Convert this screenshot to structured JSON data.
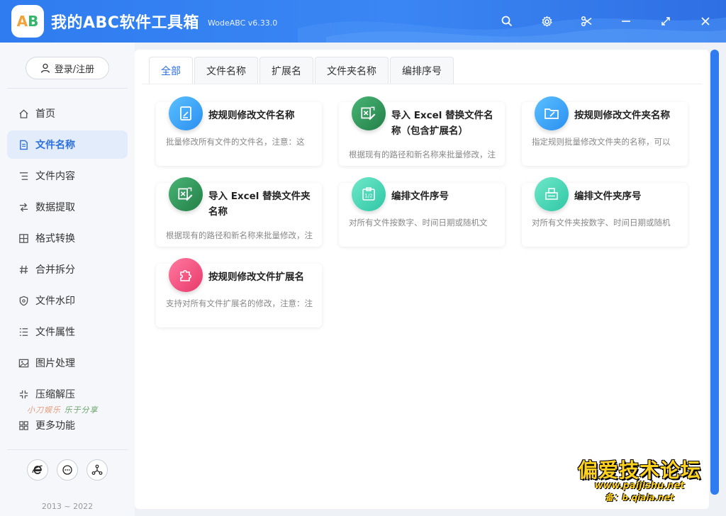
{
  "app": {
    "title": "我的ABC软件工具箱",
    "version": "WodeABC v6.33.0",
    "logo_text": "AB"
  },
  "window_buttons": [
    "search-icon",
    "gear-icon",
    "scissors-icon",
    "minimize-icon",
    "maximize-icon",
    "close-icon"
  ],
  "sidebar": {
    "login_label": "登录/注册",
    "items": [
      {
        "label": "首页",
        "icon": "home-icon"
      },
      {
        "label": "文件名称",
        "icon": "file-icon",
        "active": true
      },
      {
        "label": "文件内容",
        "icon": "list-icon"
      },
      {
        "label": "数据提取",
        "icon": "extract-icon"
      },
      {
        "label": "格式转换",
        "icon": "convert-icon"
      },
      {
        "label": "合并拆分",
        "icon": "hash-icon"
      },
      {
        "label": "文件水印",
        "icon": "shield-icon"
      },
      {
        "label": "文件属性",
        "icon": "properties-icon"
      },
      {
        "label": "图片处理",
        "icon": "image-icon"
      },
      {
        "label": "压缩解压",
        "icon": "compress-icon"
      },
      {
        "label": "更多功能",
        "icon": "grid-icon"
      }
    ],
    "bottom_icons": [
      "ie-icon",
      "chat-icon",
      "share-icon"
    ],
    "copyright": "2013 ~ 2022"
  },
  "tabs": [
    {
      "label": "全部",
      "active": true
    },
    {
      "label": "文件名称"
    },
    {
      "label": "扩展名"
    },
    {
      "label": "文件夹名称"
    },
    {
      "label": "编排序号"
    }
  ],
  "cards": [
    {
      "title": "按规则修改文件名称",
      "desc": "批量修改所有文件的文件名，注意：这",
      "icon": "edit-document-icon",
      "color": "#3aa6f6"
    },
    {
      "title": "导入 Excel 替换文件名称（包含扩展名）",
      "desc": "根据现有的路径和新名称来批量修改，注",
      "icon": "excel-icon",
      "color": "#2f9a5a"
    },
    {
      "title": "按规则修改文件夹名称",
      "desc": "指定规则批量修改文件夹的名称，可以",
      "icon": "folder-edit-icon",
      "color": "#3aa6f6"
    },
    {
      "title": "导入 Excel 替换文件夹名称",
      "desc": "根据现有的路径和新名称来批量修改，注",
      "icon": "excel-icon",
      "color": "#2f9a5a"
    },
    {
      "title": "编排文件序号",
      "desc": "对所有文件按数字、时间日期或随机文",
      "icon": "numbering-icon",
      "color": "#3ed6b4"
    },
    {
      "title": "编排文件夹序号",
      "desc": "对所有文件夹按数字、时间日期或随机",
      "icon": "folder-numbering-icon",
      "color": "#3ed6b4"
    },
    {
      "title": "按规则修改文件扩展名",
      "desc": "支持对所有文件扩展名的修改，注意：注",
      "icon": "puzzle-icon",
      "color": "#f2577f"
    }
  ],
  "watermarks": {
    "forum_name": "偏爱技术论坛",
    "forum_url": "www.paijishu.net",
    "forum_backup": "备：b.qiala.net",
    "small_1": "小刀娱乐",
    "small_2": "乐于分享"
  }
}
